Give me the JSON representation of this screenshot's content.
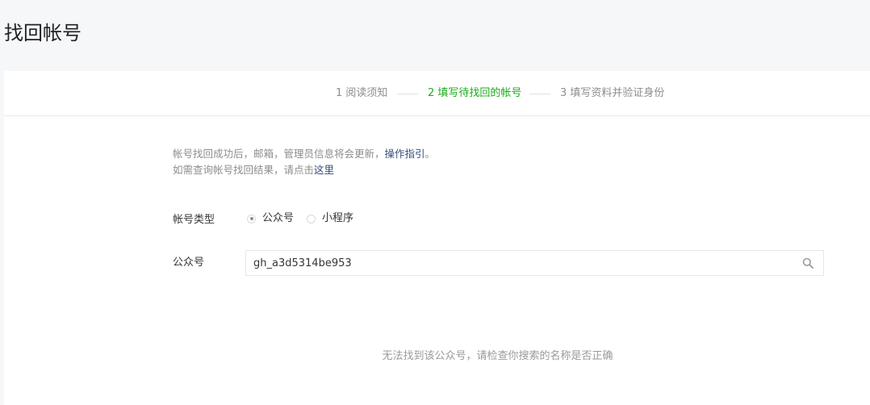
{
  "page": {
    "title": "找回帐号"
  },
  "steps": [
    {
      "label": "1 阅读须知"
    },
    {
      "label": "2 填写待找回的帐号"
    },
    {
      "label": "3 填写资料并验证身份"
    }
  ],
  "tips": {
    "line1_text": "帐号找回成功后，邮箱，管理员信息将会更新，",
    "line1_link": "操作指引",
    "line1_end": "。",
    "line2_text": "如需查询帐号找回结果，请点击",
    "line2_link": "这里"
  },
  "form": {
    "account_type_label": "帐号类型",
    "options": [
      {
        "label": "公众号",
        "checked": true
      },
      {
        "label": "小程序",
        "checked": false
      }
    ],
    "account_label": "公众号",
    "account_value": "gh_a3d5314be953"
  },
  "result": {
    "message": "无法找到该公众号，请检查你搜索的名称是否正确"
  },
  "colors": {
    "active_step": "#1aad19",
    "link": "#354e77",
    "muted": "#8d8d8d"
  }
}
